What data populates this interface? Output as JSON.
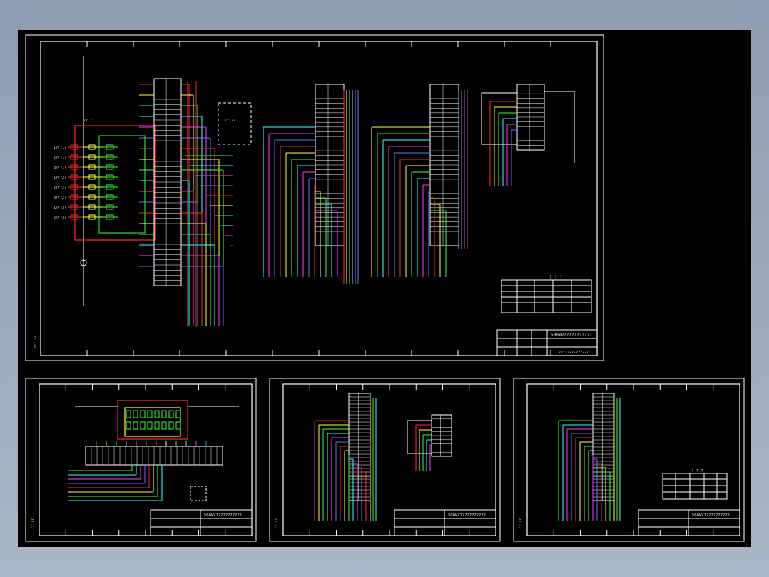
{
  "main_sheet": {
    "title_block_name": "500kV???????????",
    "title_block_code": "???-???-???-??",
    "table_title": "? ? ?",
    "box_label": "?? ??",
    "side_label": "??? ??",
    "bus_label": "?? ?",
    "left_labels": [
      "1?/?1?",
      "2?/?1?",
      "3?/?1?",
      "1?/?2?",
      "2?/?2?",
      "3?/?2?",
      "1?/?3?",
      "2?/?3?"
    ]
  },
  "sheet_a": {
    "title_block_name": "500kV???????????",
    "side_label": "?? ??"
  },
  "sheet_b": {
    "title_block_name": "500kV???????????",
    "side_label": "?? ??"
  },
  "sheet_c": {
    "title_block_name": "500kV???????????",
    "side_label": "?? ??",
    "table_title": "? ? ?"
  },
  "colors": {
    "background": "#000000",
    "frame": "#ffffff",
    "wire_red": "#ff2a2a",
    "wire_yellow": "#ffff3a",
    "wire_green": "#38ff38",
    "wire_cyan": "#3affff",
    "wire_magenta": "#ff3aff",
    "wire_blue": "#5a7aff"
  }
}
